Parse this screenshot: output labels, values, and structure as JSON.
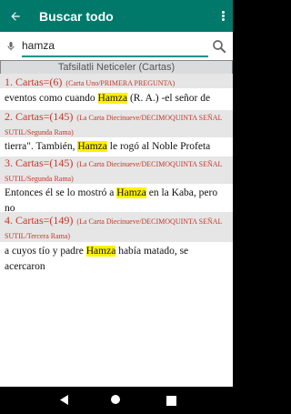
{
  "appbar": {
    "title": "Buscar todo"
  },
  "search": {
    "value": "hamza"
  },
  "section": {
    "title": "Tafsilatli Neticeler (Cartas)"
  },
  "results": [
    {
      "head_main": "1. Cartas=(6)",
      "head_sub": "(Carta Uno/PRIMERA PREGUNTA)",
      "body_before": "eventos como cuando ",
      "body_match": "Hamza",
      "body_after": " (R. A.) -el señor de"
    },
    {
      "head_main": "2. Cartas=(145)",
      "head_sub": "(La Carta Diecinueve/DECIMOQUINTA SEÑAL SUTIL/Segunda Rama)",
      "body_before": "tierra\".    También, ",
      "body_match": "Hamza",
      "body_after": " le rogó al Noble Profeta"
    },
    {
      "head_main": "3. Cartas=(145)",
      "head_sub": "(La Carta Diecinueve/DECIMOQUINTA SEÑAL SUTIL/Segunda Rama)",
      "body_before": "Entonces él se lo mostró a ",
      "body_match": "Hamza",
      "body_after": " en la Kaba, pero no"
    },
    {
      "head_main": "4. Cartas=(149)",
      "head_sub": "(La Carta Diecinueve/DECIMOQUINTA SEÑAL SUTIL/Tercera Rama)",
      "body_before": " a cuyos tío y padre ",
      "body_match": "Hamza",
      "body_after": " había matado, se acercaron"
    }
  ],
  "icons": {
    "back": "arrow-back-icon",
    "menu": "more-vert-icon",
    "mic": "mic-icon",
    "search": "search-icon"
  },
  "colors": {
    "appbar": "#00796b",
    "accent": "#009688",
    "highlight": "#fff200",
    "result_head": "#c0392b"
  }
}
